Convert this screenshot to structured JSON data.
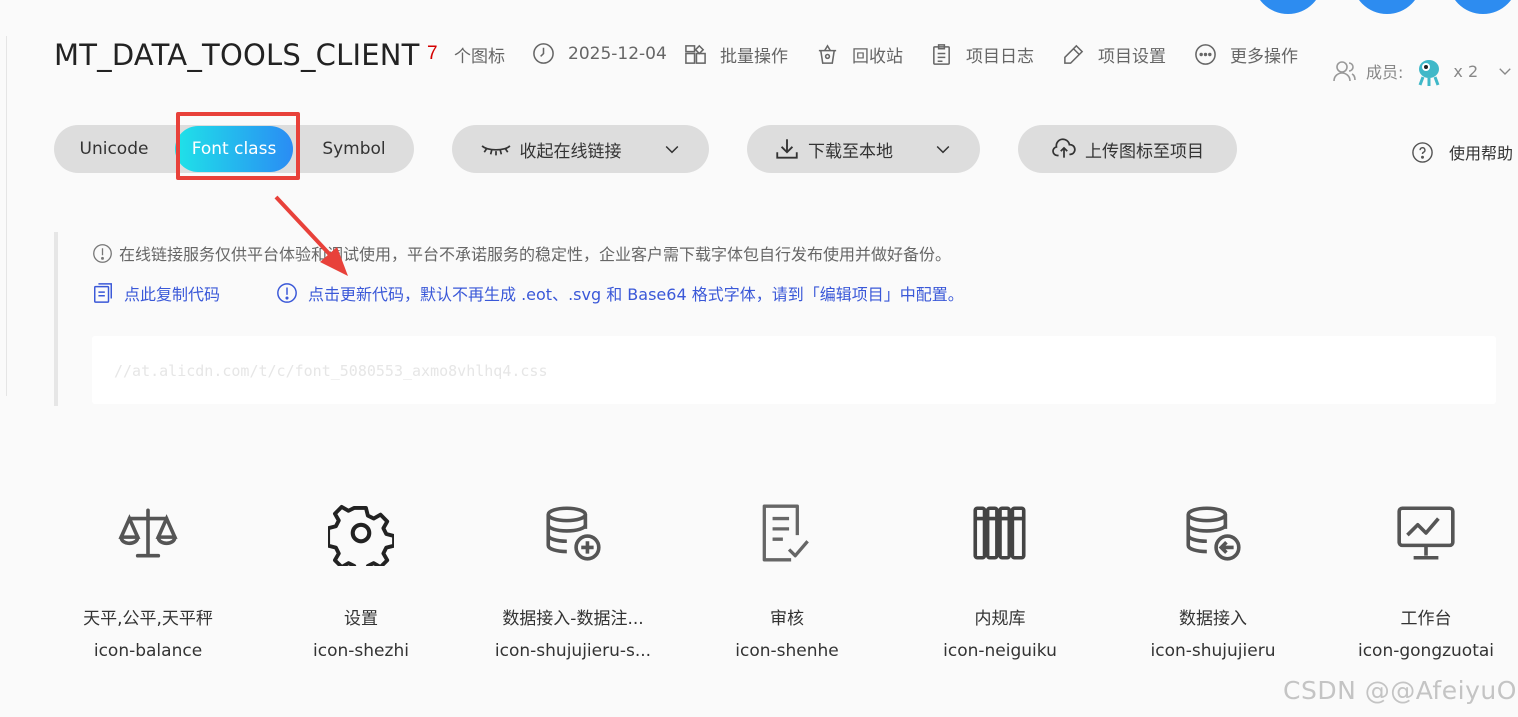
{
  "header": {
    "title": "MT_DATA_TOOLS_CLIENT",
    "icon_count": "7",
    "icon_count_label": "个图标",
    "date": "2025-12-04",
    "batch_label": "批量操作",
    "recycle_label": "回收站",
    "log_label": "项目日志",
    "settings_label": "项目设置",
    "more_label": "更多操作",
    "members_label": "成员:",
    "members_count": "x 2"
  },
  "toolbar": {
    "tabs": [
      "Unicode",
      "Font class",
      "Symbol"
    ],
    "active_tab": "Font class",
    "collapse_link_label": "收起在线链接",
    "download_label": "下载至本地",
    "upload_label": "上传图标至项目",
    "help_label": "使用帮助"
  },
  "notice": {
    "warning": "在线链接服务仅供平台体验和调试使用，平台不承诺服务的稳定性，企业客户需下载字体包自行发布使用并做好备份。",
    "copy_code": "点此复制代码",
    "update_code": "点击更新代码，默认不再生成 .eot、.svg 和 Base64 格式字体，请到「编辑项目」中配置。",
    "code_url": "//at.alicdn.com/t/c/font_5080553_axmo8vhlhq4.css"
  },
  "icons": [
    {
      "name": "天平,公平,天平秤",
      "class": "icon-balance",
      "icon": "balance-icon"
    },
    {
      "name": "设置",
      "class": "icon-shezhi",
      "icon": "gear-icon"
    },
    {
      "name": "数据接入-数据注...",
      "class": "icon-shujujieru-s...",
      "icon": "database-add-icon"
    },
    {
      "name": "审核",
      "class": "icon-shenhe",
      "icon": "document-check-icon"
    },
    {
      "name": "内规库",
      "class": "icon-neiguiku",
      "icon": "library-icon"
    },
    {
      "name": "数据接入",
      "class": "icon-shujujieru",
      "icon": "database-import-icon"
    },
    {
      "name": "工作台",
      "class": "icon-gongzuotai",
      "icon": "monitor-chart-icon"
    }
  ],
  "watermark": "CSDN @@AfeiyuO",
  "colors": {
    "accent_red": "#d40000",
    "link_blue": "#3a58d8",
    "annotation_red": "#e8413a",
    "gradient_start": "#1fe3e8",
    "gradient_end": "#2a8cf4"
  }
}
